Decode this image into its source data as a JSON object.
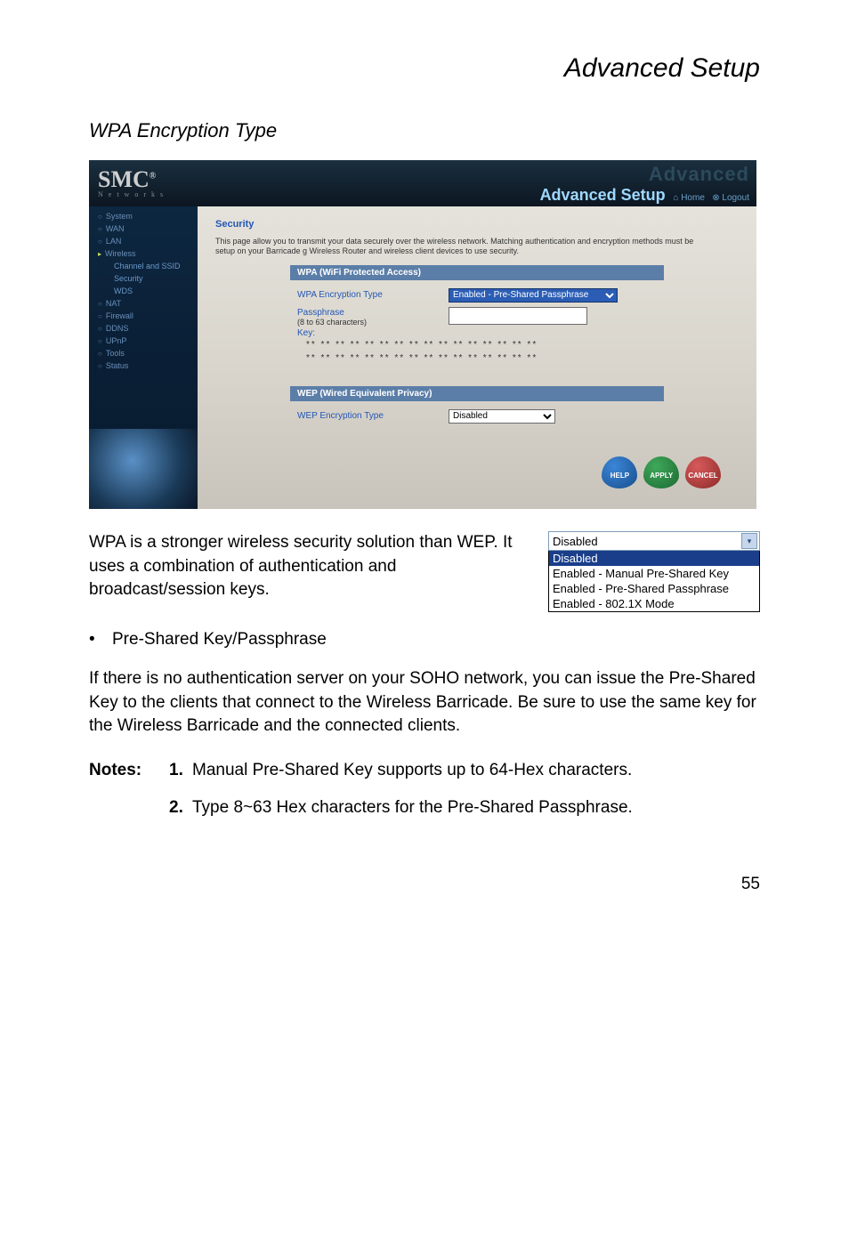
{
  "page": {
    "header": "Advanced Setup",
    "section": "WPA Encryption Type",
    "number": "55"
  },
  "screenshot": {
    "logo": "SMC",
    "logo_sub": "N e t w o r k s",
    "adv_ghost": "Advanced",
    "adv_label": "Advanced Setup",
    "home": "Home",
    "logout": "Logout",
    "sidebar": [
      "System",
      "WAN",
      "LAN",
      "Wireless",
      "NAT",
      "Firewall",
      "DDNS",
      "UPnP",
      "Tools",
      "Status"
    ],
    "sidebar_wireless_sub": [
      "Channel and SSID",
      "Security",
      "WDS"
    ],
    "content": {
      "title": "Security",
      "desc": "This page allow you to transmit your data securely over the wireless network. Matching authentication and encryption methods must be setup on your Barricade g Wireless Router and wireless client devices to use security.",
      "wpa": {
        "panel_title": "WPA (WiFi Protected Access)",
        "enc_label": "WPA Encryption Type",
        "enc_value": "Enabled - Pre-Shared Passphrase",
        "pass_label": "Passphrase",
        "pass_note": "(8 to 63 characters)",
        "key_label": "Key:",
        "dots1": "** ** ** ** ** ** ** ** ** ** ** ** ** ** ** **",
        "dots2": "** ** ** ** ** ** ** ** ** ** ** ** ** ** ** **"
      },
      "wep": {
        "panel_title": "WEP (Wired Equivalent Privacy)",
        "enc_label": "WEP Encryption Type",
        "enc_value": "Disabled"
      },
      "btn_help": "HELP",
      "btn_apply": "APPLY",
      "btn_cancel": "CANCEL"
    }
  },
  "body_text": "WPA is a stronger wireless security solution than WEP. It uses a combination of authentication and broadcast/session keys.",
  "dropdown": {
    "selected": "Disabled",
    "options": [
      "Disabled",
      "Enabled - Manual Pre-Shared Key",
      "Enabled - Pre-Shared Passphrase",
      "Enabled - 802.1X Mode"
    ]
  },
  "bullet": "Pre-Shared Key/Passphrase",
  "para": "If there is no authentication server on your SOHO network, you can issue the Pre-Shared Key to the clients that connect to the Wireless Barricade. Be sure to use the same key for the Wireless Barricade and the connected clients.",
  "notes": {
    "label": "Notes:",
    "n1_num": "1.",
    "n1_text": "Manual Pre-Shared Key supports up to 64-Hex characters.",
    "n2_num": "2.",
    "n2_text": "Type 8~63 Hex characters for the Pre-Shared Passphrase."
  }
}
